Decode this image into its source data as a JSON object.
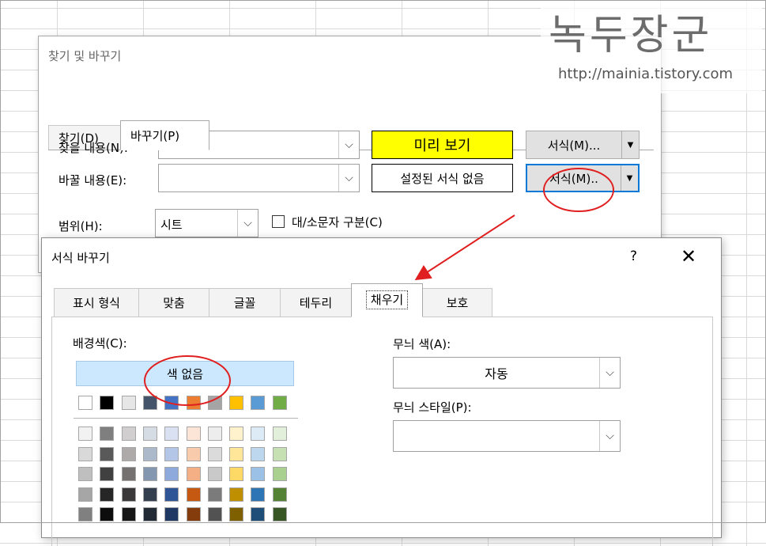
{
  "colors": {
    "highlight_yellow": "#ffff00",
    "accent_blue": "#0078d7",
    "no_color_bg": "#cce8ff",
    "annotation_red": "#e02020"
  },
  "watermark": {
    "title": "녹두장군",
    "url": "http://mainia.tistory.com"
  },
  "find_replace_dialog": {
    "title": "찾기 및 바꾸기",
    "tabs": [
      {
        "label": "찾기(D)"
      },
      {
        "label": "바꾸기(P)"
      }
    ],
    "find_label": "찾을 내용(N):",
    "replace_label": "바꿀 내용(E):",
    "find_value": "",
    "replace_value": "",
    "find_preview": "미리 보기",
    "replace_preview": "설정된 서식 없음",
    "format_button_label": "서식(M)...",
    "format_button2_label": "서식(M)..",
    "scope_label": "범위(H):",
    "scope_value": "시트",
    "match_case_label": "대/소문자 구분(C)",
    "help_label": "?",
    "close_icon": "close-icon"
  },
  "format_replace_dialog": {
    "title": "서식 바꾸기",
    "help_label": "?",
    "close_label": "✕",
    "tabs": [
      {
        "label": "표시 형식"
      },
      {
        "label": "맞춤"
      },
      {
        "label": "글꼴"
      },
      {
        "label": "테두리"
      },
      {
        "label": "채우기"
      },
      {
        "label": "보호"
      }
    ],
    "active_tab": "채우기",
    "bg_color_label": "배경색(C):",
    "no_color_button": "색 없음",
    "pattern_color_label": "무늬 색(A):",
    "pattern_color_value": "자동",
    "pattern_style_label": "무늬 스타일(P):",
    "pattern_style_value": "",
    "theme_colors": [
      "#ffffff",
      "#000000",
      "#e7e6e6",
      "#44546a",
      "#4472c4",
      "#ed7d31",
      "#a5a5a5",
      "#ffc000",
      "#5b9bd5",
      "#70ad47"
    ],
    "shade_rows": [
      [
        "#f2f2f2",
        "#7f7f7f",
        "#d0cece",
        "#d6dce4",
        "#d9e1f2",
        "#fce4d6",
        "#ededed",
        "#fff2cc",
        "#ddebf7",
        "#e2efda"
      ],
      [
        "#d9d9d9",
        "#595959",
        "#aeaaaa",
        "#acb9ca",
        "#b4c6e7",
        "#f8cbad",
        "#dbdbdb",
        "#ffe699",
        "#bdd7ee",
        "#c6e0b4"
      ],
      [
        "#bfbfbf",
        "#404040",
        "#757171",
        "#8497b0",
        "#8ea9db",
        "#f4b084",
        "#c9c9c9",
        "#ffd966",
        "#9bc2e6",
        "#a9d08e"
      ],
      [
        "#a6a6a6",
        "#262626",
        "#3a3838",
        "#333f4f",
        "#2f5597",
        "#c65911",
        "#7b7b7b",
        "#bf8f00",
        "#2e75b6",
        "#548235"
      ],
      [
        "#808080",
        "#0d0d0d",
        "#161616",
        "#222b35",
        "#203864",
        "#843c0c",
        "#525252",
        "#7f6000",
        "#1f4e78",
        "#375623"
      ]
    ]
  }
}
